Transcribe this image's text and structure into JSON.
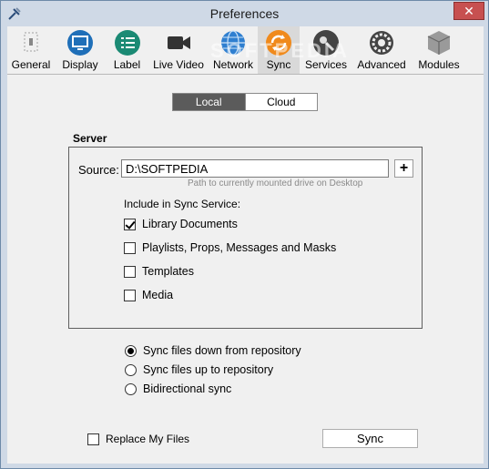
{
  "window": {
    "title": "Preferences",
    "close_glyph": "✕"
  },
  "toolbar": {
    "items": [
      {
        "label": "General",
        "icon": "general-icon"
      },
      {
        "label": "Display",
        "icon": "display-icon"
      },
      {
        "label": "Label",
        "icon": "label-icon"
      },
      {
        "label": "Live Video",
        "icon": "video-camera-icon"
      },
      {
        "label": "Network",
        "icon": "globe-icon"
      },
      {
        "label": "Sync",
        "icon": "sync-icon",
        "active": true
      },
      {
        "label": "Services",
        "icon": "services-icon"
      },
      {
        "label": "Advanced",
        "icon": "gear-icon"
      },
      {
        "label": "Modules",
        "icon": "cube-icon"
      }
    ]
  },
  "segment": {
    "local": "Local",
    "cloud": "Cloud",
    "selected": "Local"
  },
  "server": {
    "heading": "Server",
    "source_label": "Source:",
    "source_value": "D:\\SOFTPEDIA",
    "add_button": "+",
    "hint": "Path to currently mounted drive on Desktop",
    "include_label": "Include in Sync Service:",
    "options": [
      {
        "label": "Library Documents",
        "checked": true
      },
      {
        "label": "Playlists, Props, Messages and Masks",
        "checked": false
      },
      {
        "label": "Templates",
        "checked": false
      },
      {
        "label": "Media",
        "checked": false
      }
    ]
  },
  "direction": {
    "options": [
      {
        "label": "Sync files down from repository",
        "checked": true
      },
      {
        "label": "Sync files up to repository",
        "checked": false
      },
      {
        "label": "Bidirectional sync",
        "checked": false
      }
    ]
  },
  "footer": {
    "replace_label": "Replace My Files",
    "replace_checked": false,
    "sync_button": "Sync"
  },
  "watermark": "SOFTPEDIA"
}
